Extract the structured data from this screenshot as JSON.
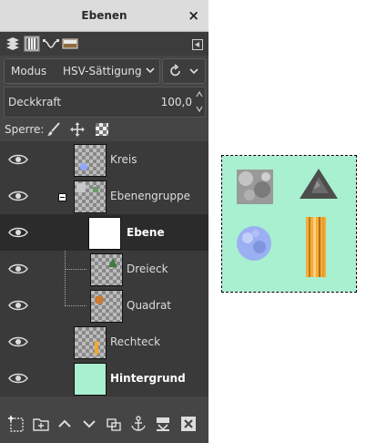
{
  "window": {
    "title": "Ebenen",
    "close_symbol": "×"
  },
  "mode": {
    "label": "Modus",
    "value": "HSV-Sättigung"
  },
  "opacity": {
    "label": "Deckkraft",
    "value": "100,0"
  },
  "lock": {
    "label": "Sperre:"
  },
  "layers": [
    {
      "name": "Kreis",
      "bold": false,
      "selected": false,
      "thumb": "circle"
    },
    {
      "name": "Ebenengruppe",
      "bold": false,
      "selected": false,
      "thumb": "group"
    },
    {
      "name": "Ebene",
      "bold": true,
      "selected": true,
      "thumb": "white"
    },
    {
      "name": "Dreieck",
      "bold": false,
      "selected": false,
      "thumb": "triangle"
    },
    {
      "name": "Quadrat",
      "bold": false,
      "selected": false,
      "thumb": "square"
    },
    {
      "name": "Rechteck",
      "bold": false,
      "selected": false,
      "thumb": "rect"
    },
    {
      "name": "Hintergrund",
      "bold": true,
      "selected": false,
      "thumb": "mint"
    }
  ],
  "colors": {
    "canvas_background": "#a8f0cf",
    "panel": "#454545",
    "selected_row": "#2b2b2b"
  },
  "icons": {
    "tabs": [
      "layers-icon",
      "channels-icon",
      "paths-icon",
      "undo-history-icon"
    ],
    "bottom": [
      "new-layer-icon",
      "new-group-icon",
      "raise-layer-icon",
      "lower-layer-icon",
      "duplicate-layer-icon",
      "anchor-layer-icon",
      "merge-layer-icon",
      "delete-layer-icon"
    ]
  }
}
